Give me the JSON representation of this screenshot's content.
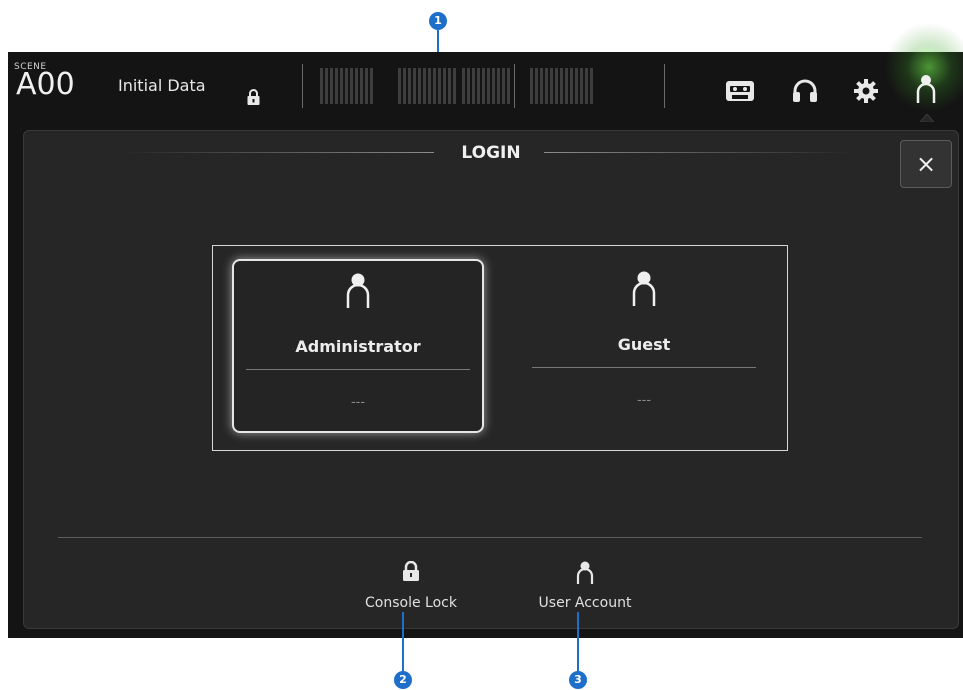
{
  "header": {
    "scene_label": "SCENE",
    "scene_number": "A00",
    "scene_name": "Initial Data",
    "icons": [
      "lock-icon",
      "recorder-icon",
      "headphones-icon",
      "gear-icon",
      "user-icon"
    ]
  },
  "dialog": {
    "title": "LOGIN",
    "close_label": "×",
    "accounts": [
      {
        "name": "Administrator",
        "value": "---",
        "selected": true
      },
      {
        "name": "Guest",
        "value": "---",
        "selected": false
      }
    ],
    "footer": {
      "console_lock_label": "Console Lock",
      "user_account_label": "User Account"
    }
  },
  "callouts": [
    "1",
    "2",
    "3"
  ],
  "colors": {
    "background": "#141414",
    "panel": "#262626",
    "callout": "#1e6fc9",
    "user_glow": "#78ff50"
  }
}
